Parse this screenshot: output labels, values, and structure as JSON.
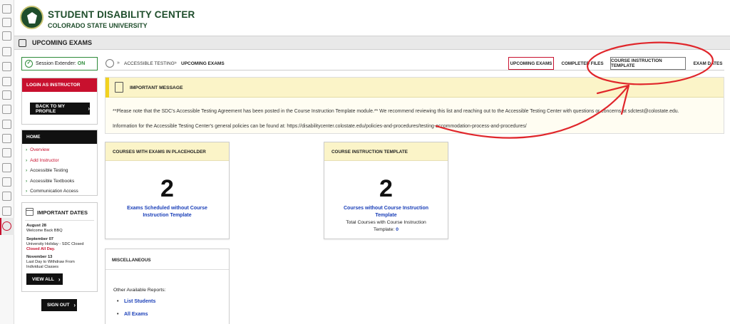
{
  "rail": {
    "icons": [
      "dashboard-icon",
      "users-icon",
      "add-user-icon",
      "calendar-icon",
      "list-icon",
      "document-icon",
      "book-icon",
      "hand-icon",
      "building-icon",
      "expand-icon",
      "file-icon",
      "chat-icon",
      "files-icon",
      "report-icon",
      "video-icon",
      "logout-icon"
    ]
  },
  "header": {
    "title": "STUDENT DISABILITY CENTER",
    "subtitle": "COLORADO STATE UNIVERSITY"
  },
  "page": {
    "title": "UPCOMING EXAMS"
  },
  "session": {
    "label": "Session Extender: ",
    "state": "ON"
  },
  "login": {
    "header": "LOGIN AS INSTRUCTOR",
    "button": "BACK TO MY PROFILE"
  },
  "home": {
    "header": "HOME",
    "items": [
      {
        "label": "Overview"
      },
      {
        "label": "Add Instructor"
      },
      {
        "label": "Accessible Testing"
      },
      {
        "label": "Accessible Textbooks"
      },
      {
        "label": "Communication Access"
      }
    ]
  },
  "dates": {
    "header": "IMPORTANT DATES",
    "d1_date": "August 28",
    "d1_text": "Welcome Back BBQ",
    "d2_date": "September 07",
    "d2_text": "University Holiday - SDC Closed",
    "d2_note": "Closed All Day.",
    "d3_date": "November 13",
    "d3_text1": "Last Day to Withdraw From",
    "d3_text2": "Individual Classes",
    "view_all": "VIEW ALL"
  },
  "sign_out": "SIGN OUT",
  "breadcrumb": {
    "level1": "ACCESSIBLE TESTING",
    "level2": "UPCOMING EXAMS"
  },
  "tabs": {
    "upcoming": "UPCOMING EXAMS",
    "completed": "COMPLETED FILES",
    "template": "COURSE INSTRUCTION TEMPLATE",
    "dates": "EXAM DATES"
  },
  "message": {
    "title": "IMPORTANT MESSAGE",
    "line1": "**Please note that the SDC's Accessible Testing Agreement has been posted in the Course Instruction Template module.** We recommend reviewing this list and reaching out to the Accessible Testing Center with questions or concerns at sdctest@colostate.edu.",
    "line2": "Information for the Accessible Testing Center's general policies can be found at: https://disabilitycenter.colostate.edu/policies-and-procedures/testing-accommodation-process-and-procedures/"
  },
  "cards": {
    "placeholder": {
      "header": "COURSES WITH EXAMS IN PLACEHOLDER",
      "count": "2",
      "link1": "Exams Scheduled without Course",
      "link2": "Instruction Template"
    },
    "template": {
      "header": "COURSE INSTRUCTION TEMPLATE",
      "count": "2",
      "link1": "Courses without Course Instruction",
      "link2": "Template",
      "total_label1": "Total Courses with Course Instruction",
      "total_label2": "Template: ",
      "total_value": "0"
    }
  },
  "misc": {
    "header": "MISCELLANEOUS",
    "other": "Other Available Reports:",
    "links": [
      "List Students",
      "All Exams"
    ]
  },
  "colors": {
    "brand_green": "#1e4d2b",
    "accent_red": "#c8102e",
    "link_blue": "#1a3fb8",
    "message_yellow": "#fbf4c8",
    "annotation_red": "#e0262b"
  }
}
